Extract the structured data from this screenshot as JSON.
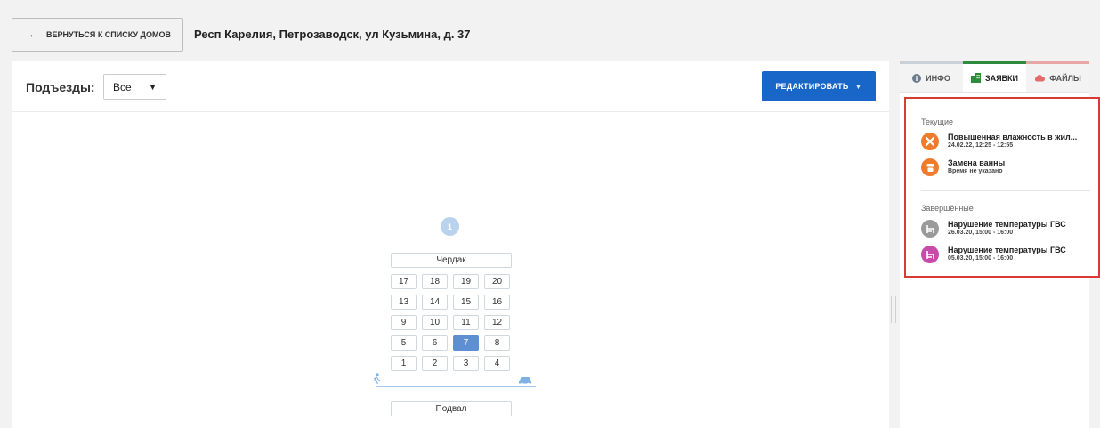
{
  "header": {
    "back_label": "ВЕРНУТЬСЯ К СПИСКУ ДОМОВ",
    "back_arrow": "←",
    "address": "Респ Карелия, Петрозаводск, ул Кузьмина, д. 37"
  },
  "toolbar": {
    "entrances_label": "Подъезды:",
    "entrance_select_value": "Все",
    "edit_label": "РЕДАКТИРОВАТЬ"
  },
  "building": {
    "entrance_number": "1",
    "attic_label": "Чердак",
    "basement_label": "Подвал",
    "floors": [
      [
        "17",
        "18",
        "19",
        "20"
      ],
      [
        "13",
        "14",
        "15",
        "16"
      ],
      [
        "9",
        "10",
        "11",
        "12"
      ],
      [
        "5",
        "6",
        "7",
        "8"
      ],
      [
        "1",
        "2",
        "3",
        "4"
      ]
    ],
    "selected_flat": "7"
  },
  "tabs": [
    {
      "label": "ИНФО",
      "icon": "info-icon"
    },
    {
      "label": "ЗАЯВКИ",
      "icon": "building-icon"
    },
    {
      "label": "ФАЙЛЫ",
      "icon": "cloud-icon"
    }
  ],
  "requests": {
    "current_title": "Текущие",
    "current": [
      {
        "title": "Повышенная влажность в жил...",
        "time": "24.02.22, 12:25 - 12:55",
        "icon": "tools-icon",
        "color": "#f07c2b"
      },
      {
        "title": "Замена ванны",
        "time": "Время не указано",
        "icon": "bath-icon",
        "color": "#f07c2b"
      }
    ],
    "completed_title": "Завершённые",
    "completed": [
      {
        "title": "Нарушение температуры ГВС",
        "time": "26.03.20, 15:00 - 16:00",
        "icon": "hot-water-icon",
        "color": "#9a9a9a"
      },
      {
        "title": "Нарушение температуры ГВС",
        "time": "05.03.20, 15:00 - 16:00",
        "icon": "hot-water-icon",
        "color": "#c94ba9"
      }
    ]
  },
  "colors": {
    "primary": "#1766c8",
    "highlight_border": "#d93a35",
    "tab_active": "#2f8a3e"
  }
}
